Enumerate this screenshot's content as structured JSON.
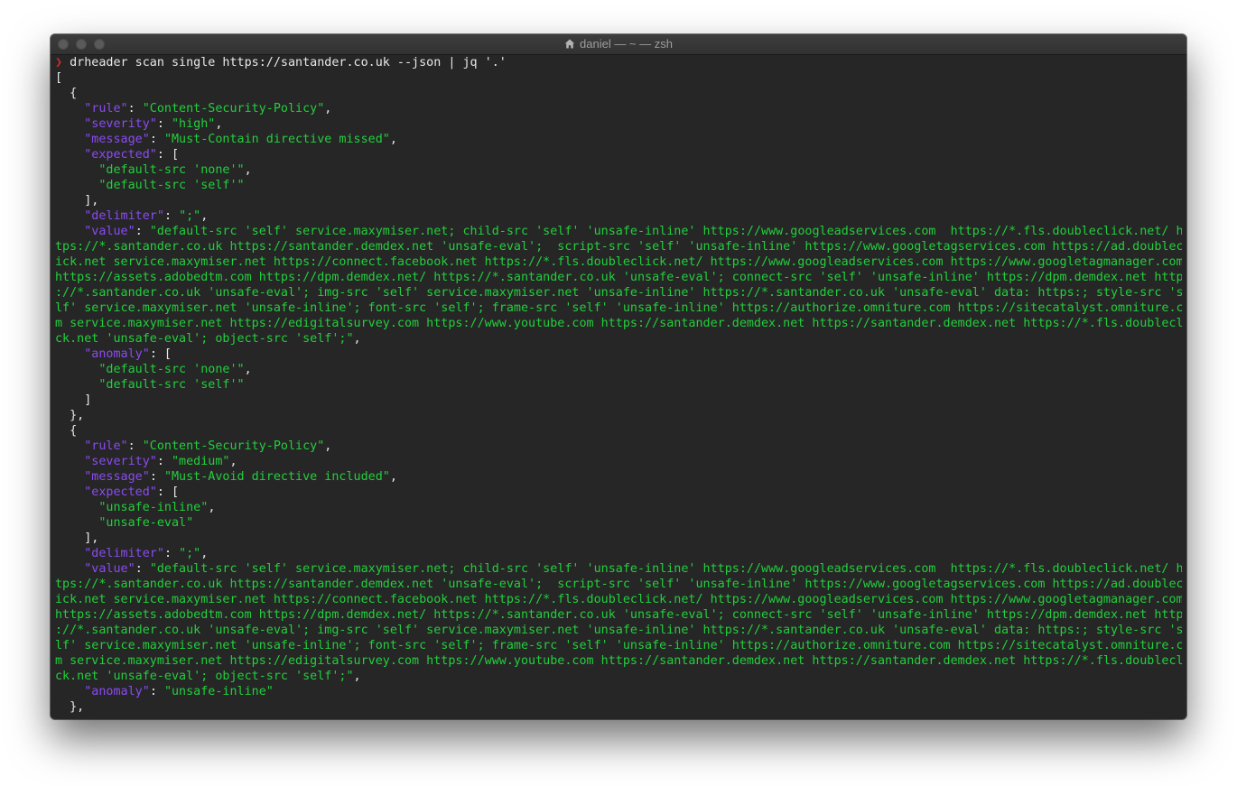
{
  "window": {
    "title": "daniel — ~ — zsh"
  },
  "icons": {
    "title_icon": "home-folder-icon",
    "prompt_icon": "prompt-chevron-icon"
  },
  "colors": {
    "background": "#262626",
    "key": "#8a4bf2",
    "string": "#22cf3c",
    "prompt": "#c62e2e",
    "text": "#e8e8e8"
  },
  "terminal": {
    "prompt_symbol": "❯",
    "command": "drheader scan single https://santander.co.uk --json | jq '.'",
    "lines": [
      [
        [
          "p",
          "["
        ]
      ],
      [
        [
          "p",
          "  {"
        ]
      ],
      [
        [
          "p",
          "    "
        ],
        [
          "k",
          "\"rule\""
        ],
        [
          "p",
          ": "
        ],
        [
          "s",
          "\"Content-Security-Policy\""
        ],
        [
          "p",
          ","
        ]
      ],
      [
        [
          "p",
          "    "
        ],
        [
          "k",
          "\"severity\""
        ],
        [
          "p",
          ": "
        ],
        [
          "s",
          "\"high\""
        ],
        [
          "p",
          ","
        ]
      ],
      [
        [
          "p",
          "    "
        ],
        [
          "k",
          "\"message\""
        ],
        [
          "p",
          ": "
        ],
        [
          "s",
          "\"Must-Contain directive missed\""
        ],
        [
          "p",
          ","
        ]
      ],
      [
        [
          "p",
          "    "
        ],
        [
          "k",
          "\"expected\""
        ],
        [
          "p",
          ": ["
        ]
      ],
      [
        [
          "p",
          "      "
        ],
        [
          "s",
          "\"default-src 'none'\""
        ],
        [
          "p",
          ","
        ]
      ],
      [
        [
          "p",
          "      "
        ],
        [
          "s",
          "\"default-src 'self'\""
        ]
      ],
      [
        [
          "p",
          "    ],"
        ]
      ],
      [
        [
          "p",
          "    "
        ],
        [
          "k",
          "\"delimiter\""
        ],
        [
          "p",
          ": "
        ],
        [
          "s",
          "\";\""
        ],
        [
          "p",
          ","
        ]
      ],
      [
        [
          "p",
          "    "
        ],
        [
          "k",
          "\"value\""
        ],
        [
          "p",
          ": "
        ],
        [
          "s",
          "\"default-src 'self' service.maxymiser.net; child-src 'self' 'unsafe-inline' https://www.googleadservices.com  https://*.fls.doubleclick.net/ ht"
        ]
      ],
      [
        [
          "s",
          "tps://*.santander.co.uk https://santander.demdex.net 'unsafe-eval';  script-src 'self' 'unsafe-inline' https://www.googletagservices.com https://ad.doublecl"
        ]
      ],
      [
        [
          "s",
          "ick.net service.maxymiser.net https://connect.facebook.net https://*.fls.doubleclick.net/ https://www.googleadservices.com https://www.googletagmanager.com"
        ]
      ],
      [
        [
          "s",
          "https://assets.adobedtm.com https://dpm.demdex.net/ https://*.santander.co.uk 'unsafe-eval'; connect-src 'self' 'unsafe-inline' https://dpm.demdex.net https"
        ]
      ],
      [
        [
          "s",
          "://*.santander.co.uk 'unsafe-eval'; img-src 'self' service.maxymiser.net 'unsafe-inline' https://*.santander.co.uk 'unsafe-eval' data: https:; style-src 'se"
        ]
      ],
      [
        [
          "s",
          "lf' service.maxymiser.net 'unsafe-inline'; font-src 'self'; frame-src 'self' 'unsafe-inline' https://authorize.omniture.com https://sitecatalyst.omniture.co"
        ]
      ],
      [
        [
          "s",
          "m service.maxymiser.net https://edigitalsurvey.com https://www.youtube.com https://santander.demdex.net https://santander.demdex.net https://*.fls.doublecli"
        ]
      ],
      [
        [
          "s",
          "ck.net 'unsafe-eval'; object-src 'self';\""
        ],
        [
          "p",
          ","
        ]
      ],
      [
        [
          "p",
          "    "
        ],
        [
          "k",
          "\"anomaly\""
        ],
        [
          "p",
          ": ["
        ]
      ],
      [
        [
          "p",
          "      "
        ],
        [
          "s",
          "\"default-src 'none'\""
        ],
        [
          "p",
          ","
        ]
      ],
      [
        [
          "p",
          "      "
        ],
        [
          "s",
          "\"default-src 'self'\""
        ]
      ],
      [
        [
          "p",
          "    ]"
        ]
      ],
      [
        [
          "p",
          "  },"
        ]
      ],
      [
        [
          "p",
          "  {"
        ]
      ],
      [
        [
          "p",
          "    "
        ],
        [
          "k",
          "\"rule\""
        ],
        [
          "p",
          ": "
        ],
        [
          "s",
          "\"Content-Security-Policy\""
        ],
        [
          "p",
          ","
        ]
      ],
      [
        [
          "p",
          "    "
        ],
        [
          "k",
          "\"severity\""
        ],
        [
          "p",
          ": "
        ],
        [
          "s",
          "\"medium\""
        ],
        [
          "p",
          ","
        ]
      ],
      [
        [
          "p",
          "    "
        ],
        [
          "k",
          "\"message\""
        ],
        [
          "p",
          ": "
        ],
        [
          "s",
          "\"Must-Avoid directive included\""
        ],
        [
          "p",
          ","
        ]
      ],
      [
        [
          "p",
          "    "
        ],
        [
          "k",
          "\"expected\""
        ],
        [
          "p",
          ": ["
        ]
      ],
      [
        [
          "p",
          "      "
        ],
        [
          "s",
          "\"unsafe-inline\""
        ],
        [
          "p",
          ","
        ]
      ],
      [
        [
          "p",
          "      "
        ],
        [
          "s",
          "\"unsafe-eval\""
        ]
      ],
      [
        [
          "p",
          "    ],"
        ]
      ],
      [
        [
          "p",
          "    "
        ],
        [
          "k",
          "\"delimiter\""
        ],
        [
          "p",
          ": "
        ],
        [
          "s",
          "\";\""
        ],
        [
          "p",
          ","
        ]
      ],
      [
        [
          "p",
          "    "
        ],
        [
          "k",
          "\"value\""
        ],
        [
          "p",
          ": "
        ],
        [
          "s",
          "\"default-src 'self' service.maxymiser.net; child-src 'self' 'unsafe-inline' https://www.googleadservices.com  https://*.fls.doubleclick.net/ ht"
        ]
      ],
      [
        [
          "s",
          "tps://*.santander.co.uk https://santander.demdex.net 'unsafe-eval';  script-src 'self' 'unsafe-inline' https://www.googletagservices.com https://ad.doublecl"
        ]
      ],
      [
        [
          "s",
          "ick.net service.maxymiser.net https://connect.facebook.net https://*.fls.doubleclick.net/ https://www.googleadservices.com https://www.googletagmanager.com"
        ]
      ],
      [
        [
          "s",
          "https://assets.adobedtm.com https://dpm.demdex.net/ https://*.santander.co.uk 'unsafe-eval'; connect-src 'self' 'unsafe-inline' https://dpm.demdex.net https"
        ]
      ],
      [
        [
          "s",
          "://*.santander.co.uk 'unsafe-eval'; img-src 'self' service.maxymiser.net 'unsafe-inline' https://*.santander.co.uk 'unsafe-eval' data: https:; style-src 'se"
        ]
      ],
      [
        [
          "s",
          "lf' service.maxymiser.net 'unsafe-inline'; font-src 'self'; frame-src 'self' 'unsafe-inline' https://authorize.omniture.com https://sitecatalyst.omniture.co"
        ]
      ],
      [
        [
          "s",
          "m service.maxymiser.net https://edigitalsurvey.com https://www.youtube.com https://santander.demdex.net https://santander.demdex.net https://*.fls.doublecli"
        ]
      ],
      [
        [
          "s",
          "ck.net 'unsafe-eval'; object-src 'self';\""
        ],
        [
          "p",
          ","
        ]
      ],
      [
        [
          "p",
          "    "
        ],
        [
          "k",
          "\"anomaly\""
        ],
        [
          "p",
          ": "
        ],
        [
          "s",
          "\"unsafe-inline\""
        ]
      ],
      [
        [
          "p",
          "  },"
        ]
      ]
    ]
  }
}
